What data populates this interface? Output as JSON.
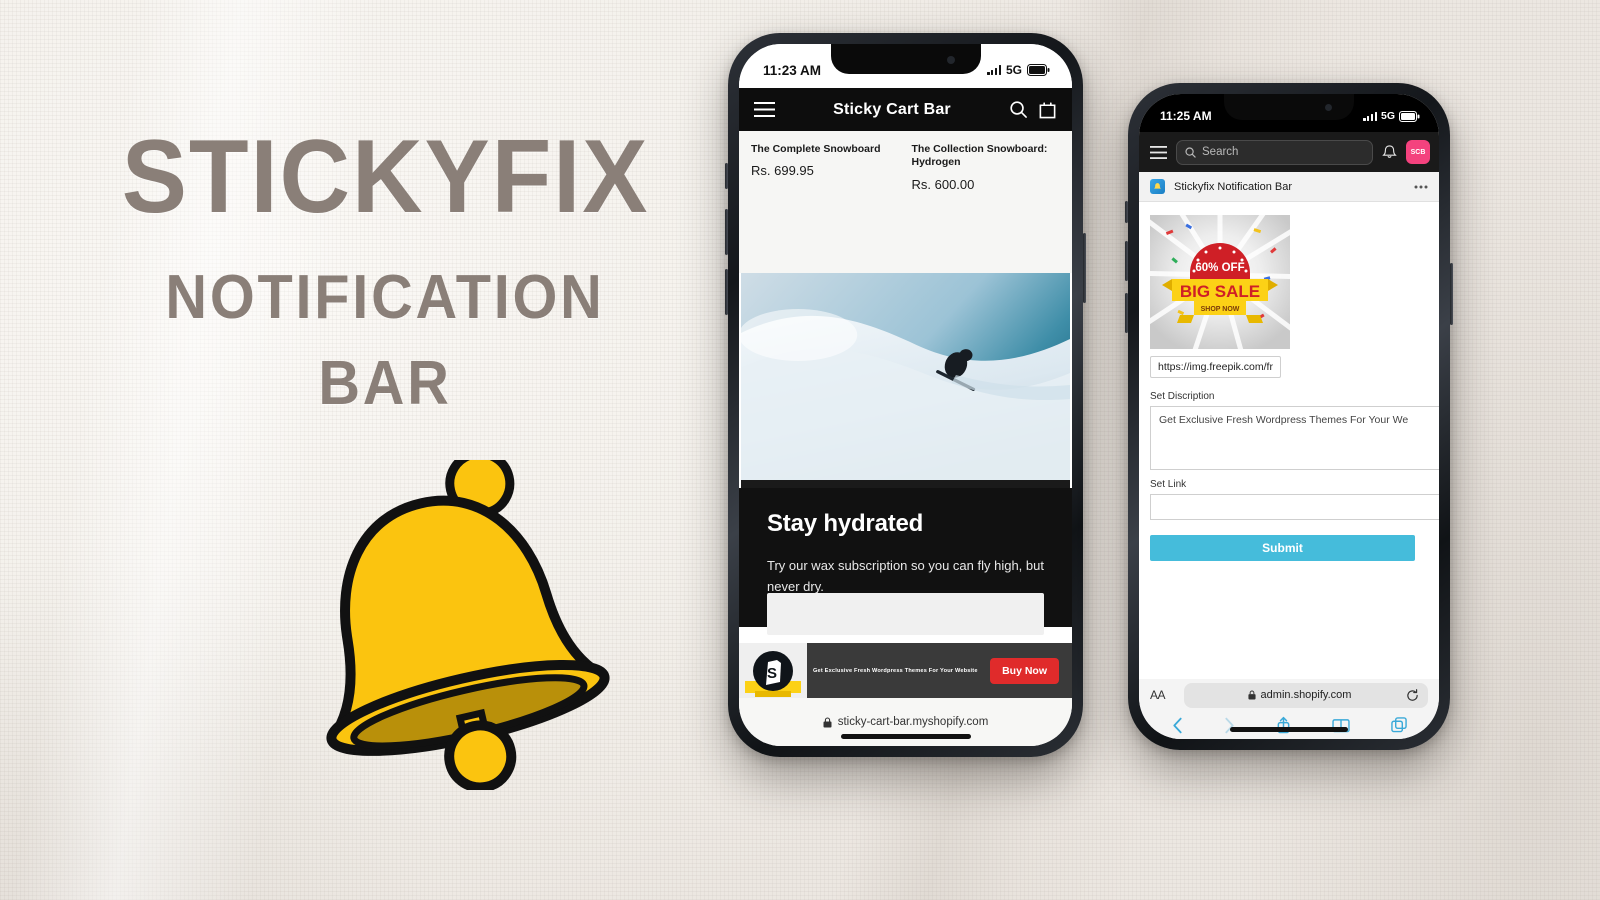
{
  "poster": {
    "title_main": "STICKYFIX",
    "title_sub1": "NOTIFICATION",
    "title_sub2": "BAR",
    "title_color": "#8a7f78",
    "background_color": "#f3efeb",
    "bell_color": "#fbc40f",
    "bell_outline": "#111111",
    "bell_icon": "bell-icon"
  },
  "phone1": {
    "status": {
      "time": "11:23 AM",
      "network": "5G",
      "signal_icon": "signal-bars-icon",
      "battery_icon": "battery-full-icon"
    },
    "topbar": {
      "menu_icon": "hamburger-menu-icon",
      "title": "Sticky Cart Bar",
      "search_icon": "search-icon",
      "cart_icon": "shopping-bag-icon",
      "background": "#0d0d0d"
    },
    "products": [
      {
        "name": "The Complete Snowboard",
        "price": "Rs. 699.95"
      },
      {
        "name": "The Collection Snowboard: Hydrogen",
        "price": "Rs. 600.00"
      }
    ],
    "hero": {
      "alt": "snowboarder-on-slope",
      "sky_color": "#2b7e99",
      "snow_color": "#dfe9ef"
    },
    "promo": {
      "heading": "Stay hydrated",
      "body": "Try our wax subscription so you can fly high, but never dry.",
      "background": "#111111"
    },
    "sticky_bar": {
      "logo_icon": "shopify-bag-icon",
      "message": "Get Exclusive Fresh Wordpress Themes For Your Website",
      "cta_label": "Buy Now",
      "cta_color": "#e02b2b",
      "background": "#3a3a3a"
    },
    "urlbar": {
      "lock_icon": "lock-icon",
      "url": "sticky-cart-bar.myshopify.com"
    }
  },
  "phone2": {
    "status": {
      "time": "11:25 AM",
      "network": "5G",
      "signal_icon": "signal-bars-icon",
      "battery_icon": "battery-full-icon"
    },
    "topbar": {
      "menu_icon": "hamburger-menu-icon",
      "search_icon": "search-icon",
      "search_placeholder": "Search",
      "bell_icon": "notification-bell-icon",
      "avatar_label": "SCB",
      "avatar_color": "#f4427e",
      "background": "#1a1a1a"
    },
    "app_row": {
      "app_icon": "stickyfix-app-icon",
      "title": "Stickyfix Notification Bar",
      "more_icon": "more-horizontal-icon"
    },
    "banner": {
      "discount": "60% OFF",
      "headline": "BIG SALE",
      "cta": "SHOP NOW",
      "red": "#d32027",
      "yellow": "#fcd116"
    },
    "image_url_field": {
      "value": "https://img.freepik.com/fr"
    },
    "description_field": {
      "label": "Set Discription",
      "value": "Get Exclusive Fresh Wordpress Themes For Your We"
    },
    "link_field": {
      "label": "Set Link",
      "value": ""
    },
    "submit_button": {
      "label": "Submit",
      "color": "#45bcdb"
    },
    "safari": {
      "text_size_label": "AA",
      "lock_icon": "lock-icon",
      "url": "admin.shopify.com",
      "reload_icon": "reload-icon"
    },
    "nav": {
      "back_icon": "chevron-left-icon",
      "forward_icon": "chevron-right-icon",
      "share_icon": "share-icon",
      "bookmarks_icon": "book-icon",
      "tabs_icon": "tabs-icon",
      "tint": "#3aa9d8"
    }
  }
}
